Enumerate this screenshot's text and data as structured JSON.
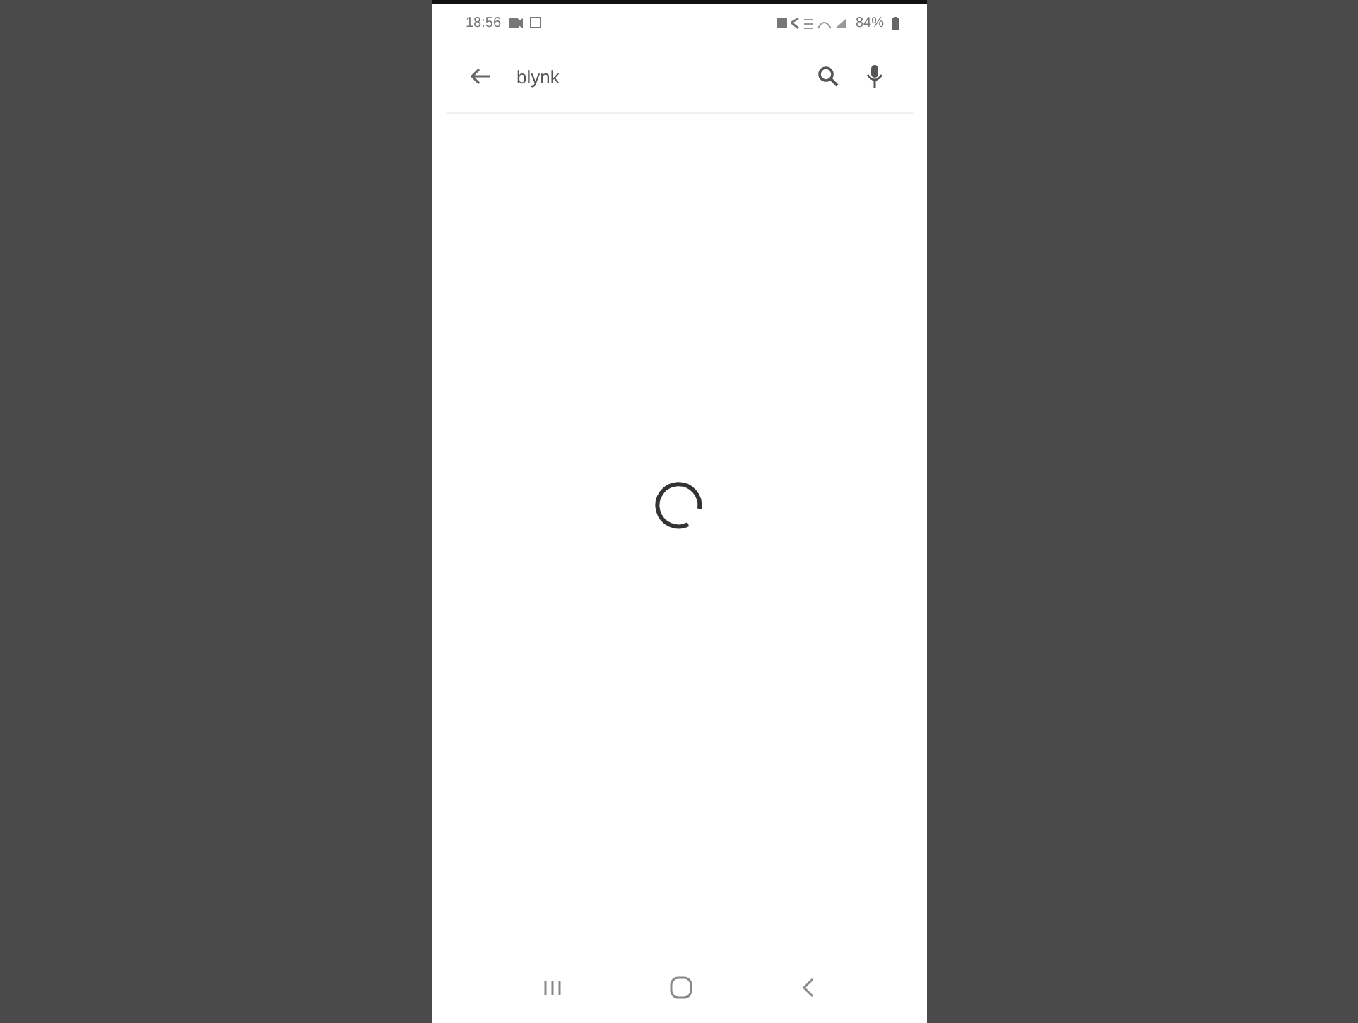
{
  "status_bar": {
    "time": "18:56",
    "battery": "84%"
  },
  "search": {
    "value": "blynk"
  },
  "loading": true
}
